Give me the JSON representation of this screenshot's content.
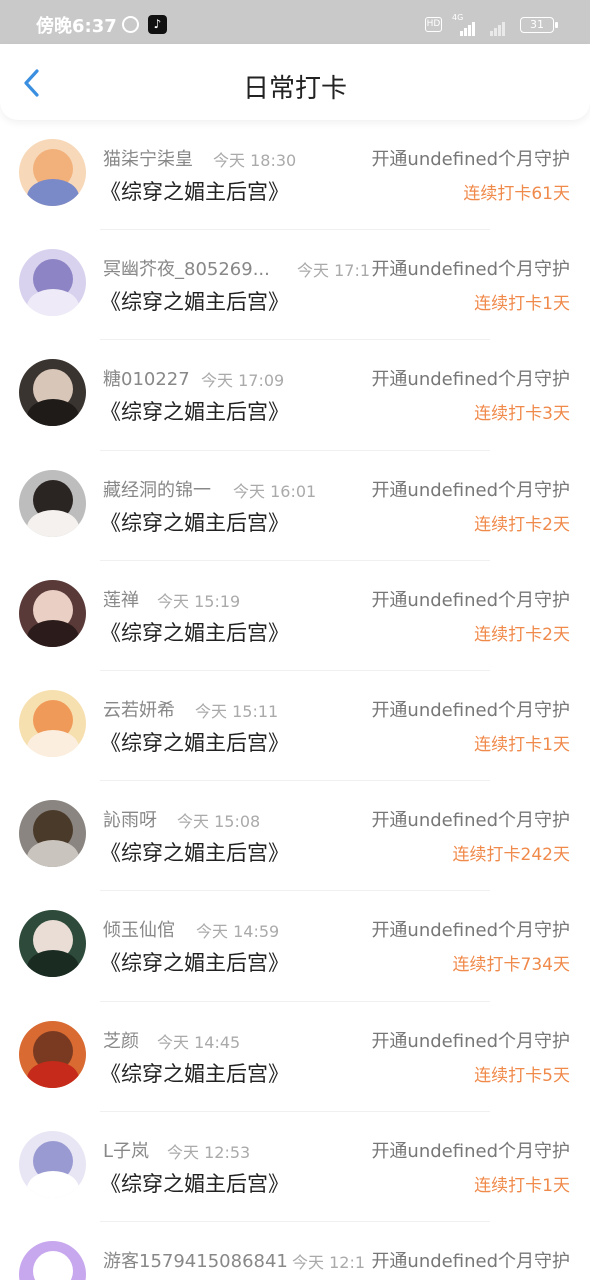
{
  "status_bar": {
    "time": "傍晚6:37",
    "network": "4G",
    "hd_label": "HD",
    "battery": "31"
  },
  "header": {
    "title": "日常打卡"
  },
  "entries": [
    {
      "user": "猫柒宁柒皇",
      "time": "今天 18:30",
      "book": "《综穿之媚主后宫》",
      "guard": "开通undefined个月守护",
      "streak": "连续打卡61天",
      "avatar": [
        "#f7d8b8",
        "#f2b07a",
        "#7a89c8"
      ]
    },
    {
      "user": "冥幽芥夜_805269...",
      "time": "今天 17:1",
      "book": "《综穿之媚主后宫》",
      "guard": "开通undefined个月守护",
      "streak": "连续打卡1天",
      "avatar": [
        "#d9d2ee",
        "#8c84c4",
        "#efeaf8"
      ]
    },
    {
      "user": "糖010227",
      "time": "今天 17:09",
      "book": "《综穿之媚主后宫》",
      "guard": "开通undefined个月守护",
      "streak": "连续打卡3天",
      "avatar": [
        "#3a3430",
        "#d8c6b8",
        "#1f1b19"
      ]
    },
    {
      "user": "藏经洞的锦一",
      "time": "今天 16:01",
      "book": "《综穿之媚主后宫》",
      "guard": "开通undefined个月守护",
      "streak": "连续打卡2天",
      "avatar": [
        "#bdbdbd",
        "#2a2422",
        "#f4f1ee"
      ]
    },
    {
      "user": "莲禅",
      "time": "今天 15:19",
      "book": "《综穿之媚主后宫》",
      "guard": "开通undefined个月守护",
      "streak": "连续打卡2天",
      "avatar": [
        "#5a3a38",
        "#e9cfc4",
        "#2b1c1b"
      ]
    },
    {
      "user": "云若妍希",
      "time": "今天 15:11",
      "book": "《综穿之媚主后宫》",
      "guard": "开通undefined个月守护",
      "streak": "连续打卡1天",
      "avatar": [
        "#f7e0b0",
        "#f09a5a",
        "#fbeede"
      ]
    },
    {
      "user": "訫雨呀",
      "time": "今天 15:08",
      "book": "《综穿之媚主后宫》",
      "guard": "开通undefined个月守护",
      "streak": "连续打卡242天",
      "avatar": [
        "#8a8580",
        "#4a3a2a",
        "#c9c4bd"
      ]
    },
    {
      "user": "倾玉仙倌",
      "time": "今天 14:59",
      "book": "《综穿之媚主后宫》",
      "guard": "开通undefined个月守护",
      "streak": "连续打卡734天",
      "avatar": [
        "#2e4a3a",
        "#e9ddd6",
        "#1a2b22"
      ]
    },
    {
      "user": "芝颜",
      "time": "今天 14:45",
      "book": "《综穿之媚主后宫》",
      "guard": "开通undefined个月守护",
      "streak": "连续打卡5天",
      "avatar": [
        "#d86a32",
        "#7a3a22",
        "#c62a1a"
      ]
    },
    {
      "user": "L子岚",
      "time": "今天 12:53",
      "book": "《综穿之媚主后宫》",
      "guard": "开通undefined个月守护",
      "streak": "连续打卡1天",
      "avatar": [
        "#e8e6f4",
        "#9a9ad2",
        "#ffffff"
      ]
    },
    {
      "user": "游客1579415086841",
      "time": "今天 12:1",
      "book": "《综穿之媚主后宫》",
      "guard": "开通undefined个月守护",
      "streak": "",
      "avatar": [
        "#c7a8ee",
        "#ffffff",
        "#b38ae6"
      ]
    }
  ],
  "colors": {
    "accent": "#f08a4b",
    "back": "#3a8fe0"
  }
}
